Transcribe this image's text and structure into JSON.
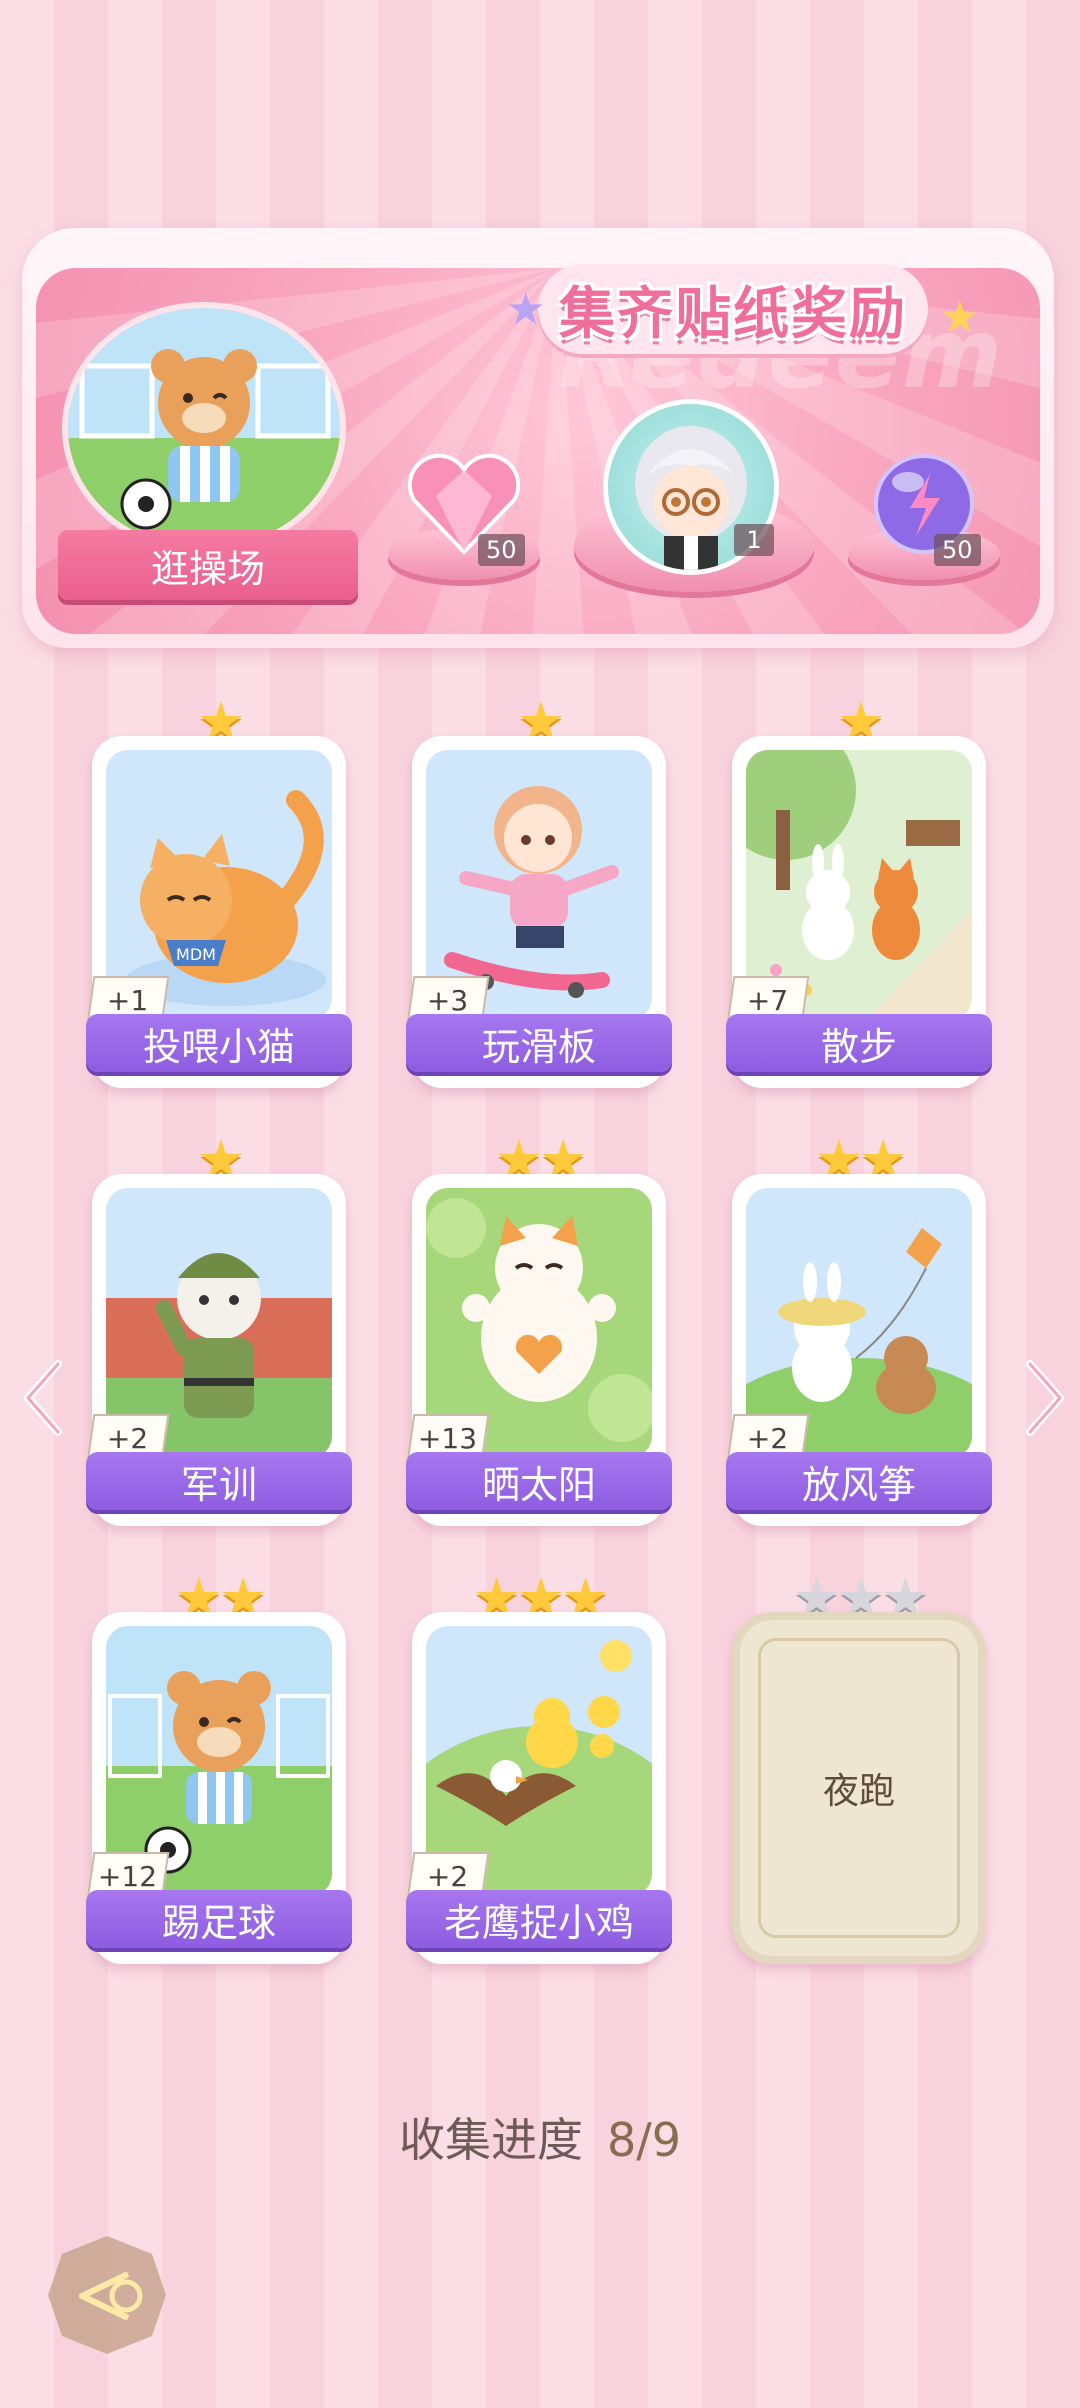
{
  "banner": {
    "title": "集齐贴纸奖励",
    "watermark": "Redeem",
    "stage_label": "逛操场",
    "rewards": [
      {
        "name": "heart-gem-icon",
        "count": "50"
      },
      {
        "name": "avatar-frame-icon",
        "count": "1"
      },
      {
        "name": "energy-orb-icon",
        "count": "50"
      }
    ]
  },
  "cards": [
    {
      "name": "投喂小猫",
      "bonus": "+1",
      "stars": "★"
    },
    {
      "name": "玩滑板",
      "bonus": "+3",
      "stars": "★"
    },
    {
      "name": "散步",
      "bonus": "+7",
      "stars": "★"
    },
    {
      "name": "军训",
      "bonus": "+2",
      "stars": "★"
    },
    {
      "name": "晒太阳",
      "bonus": "+13",
      "stars": "★★"
    },
    {
      "name": "放风筝",
      "bonus": "+2",
      "stars": "★★"
    },
    {
      "name": "踢足球",
      "bonus": "+12",
      "stars": "★★"
    },
    {
      "name": "老鹰捉小鸡",
      "bonus": "+2",
      "stars": "★★★"
    },
    {
      "name": "夜跑",
      "bonus": "",
      "stars": "★★★",
      "locked": true
    }
  ],
  "progress": {
    "label": "收集进度",
    "value": "8/9"
  },
  "colors": {
    "accent": "#f06e9a",
    "label_purple": "#9a66e8",
    "star_gold": "#ffc93c"
  }
}
